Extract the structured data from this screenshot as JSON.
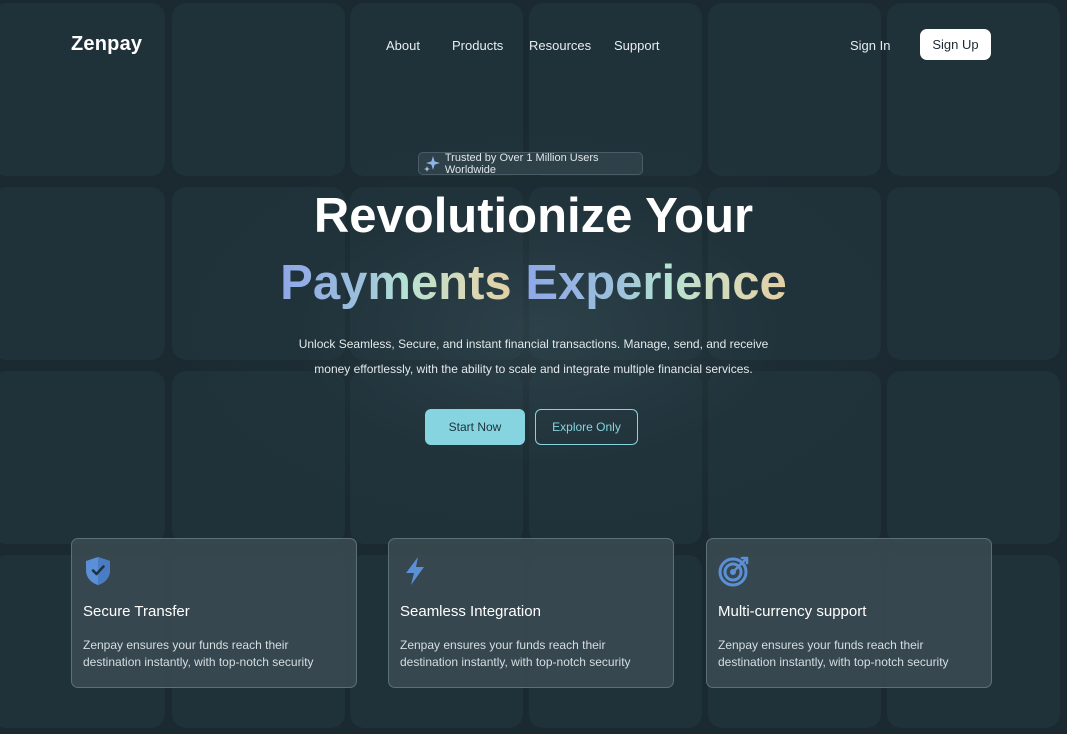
{
  "nav": {
    "logo": "Zenpay",
    "links": [
      "About",
      "Products",
      "Resources",
      "Support"
    ],
    "sign_in": "Sign In",
    "sign_up": "Sign Up"
  },
  "hero": {
    "badge": "Trusted by Over 1 Million Users Worldwide",
    "title_line1": "Revolutionize Your",
    "title_word_a": "Payments",
    "title_word_b": "Experience",
    "description_line1": "Unlock Seamless, Secure, and instant financial transactions. Manage, send, and receive",
    "description_line2": "money effortlessly, with the ability to scale and integrate multiple financial services.",
    "primary_button": "Start Now",
    "secondary_button": "Explore Only"
  },
  "features": [
    {
      "icon": "shield-check-icon",
      "title": "Secure Transfer",
      "description": "Zenpay ensures your funds reach their destination instantly, with top-notch security"
    },
    {
      "icon": "lightning-bolt-icon",
      "title": "Seamless Integration",
      "description": "Zenpay ensures your funds reach their destination instantly, with top-notch security"
    },
    {
      "icon": "target-icon",
      "title": "Multi-currency support",
      "description": "Zenpay ensures your funds reach their destination instantly, with top-notch security"
    }
  ],
  "colors": {
    "background": "#1b2a31",
    "accent": "#86d4df",
    "icon_blue": "#5b8fd6",
    "gradient_start": "#8fa7e8",
    "gradient_end": "#e2cfa4"
  }
}
